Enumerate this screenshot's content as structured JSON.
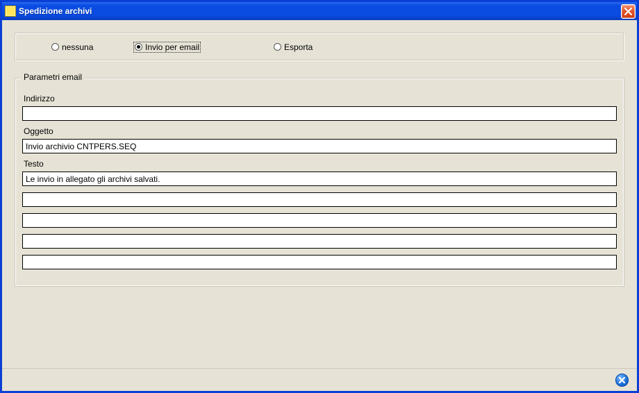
{
  "window": {
    "title": "Spedizione archivi"
  },
  "radios": {
    "none_label": "nessuna",
    "email_label": "Invio per email",
    "export_label": "Esporta",
    "selected": "email"
  },
  "fieldset": {
    "legend": "Parametri email",
    "address_label": "Indirizzo",
    "address_value": "",
    "subject_label": "Oggetto",
    "subject_value": "Invio archivio CNTPERS.SEQ",
    "body_label": "Testo",
    "body_lines": [
      "Le invio in allegato gli archivi salvati.",
      "",
      "",
      "",
      ""
    ]
  },
  "icons": {
    "close_x": "close",
    "status_close": "close-circle"
  }
}
